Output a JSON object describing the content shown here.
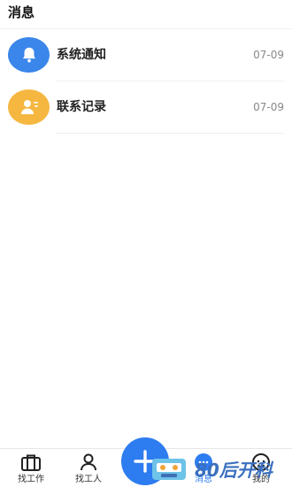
{
  "header": {
    "title": "消息"
  },
  "messages": [
    {
      "name": "系统通知",
      "date": "07-09",
      "icon": "bell-icon",
      "color": "#3a86ea"
    },
    {
      "name": "联系记录",
      "date": "07-09",
      "icon": "contact-icon",
      "color": "#f5b740"
    }
  ],
  "tabbar": {
    "tabs": [
      {
        "label": "找工作",
        "icon": "briefcase-icon"
      },
      {
        "label": "找工人",
        "icon": "person-icon"
      },
      {
        "label": "消息",
        "icon": "message-icon",
        "active": true
      },
      {
        "label": "我的",
        "icon": "profile-icon"
      }
    ],
    "fab_icon": "plus-icon"
  },
  "colors": {
    "accent": "#2d7cf0"
  },
  "watermark": {
    "text": "80后开科"
  }
}
